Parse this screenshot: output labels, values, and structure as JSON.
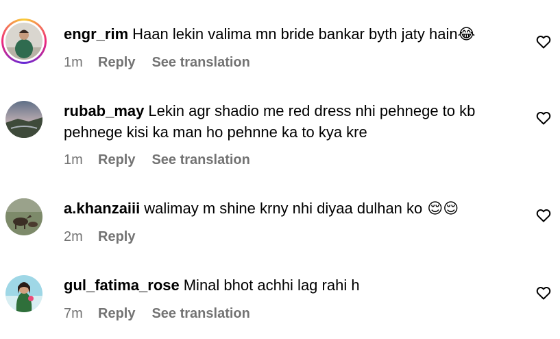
{
  "comments": [
    {
      "username": "engr_rim",
      "text": "Haan lekin valima mn bride bankar byth jaty hain",
      "emoji": "😂",
      "time": "1m",
      "reply": "Reply",
      "translate": "See translation"
    },
    {
      "username": "rubab_may",
      "text": "Lekin agr shadio me red dress nhi pehnege to kb pehnege kisi ka man ho pehnne ka to kya kre",
      "emoji": "",
      "time": "1m",
      "reply": "Reply",
      "translate": "See translation"
    },
    {
      "username": "a.khanzaiii",
      "text": "walimay m shine krny nhi diyaa dulhan ko",
      "emoji": " 😌😌",
      "time": "2m",
      "reply": "Reply"
    },
    {
      "username": "gul_fatima_rose",
      "text": "Minal bhot achhi lag rahi h",
      "emoji": "",
      "time": "7m",
      "reply": "Reply",
      "translate": "See translation"
    }
  ],
  "icons": {
    "like": "heart-outline-icon"
  },
  "colors": {
    "text": "#000000",
    "meta": "#737373",
    "story_ring": "#ee2a7b"
  }
}
